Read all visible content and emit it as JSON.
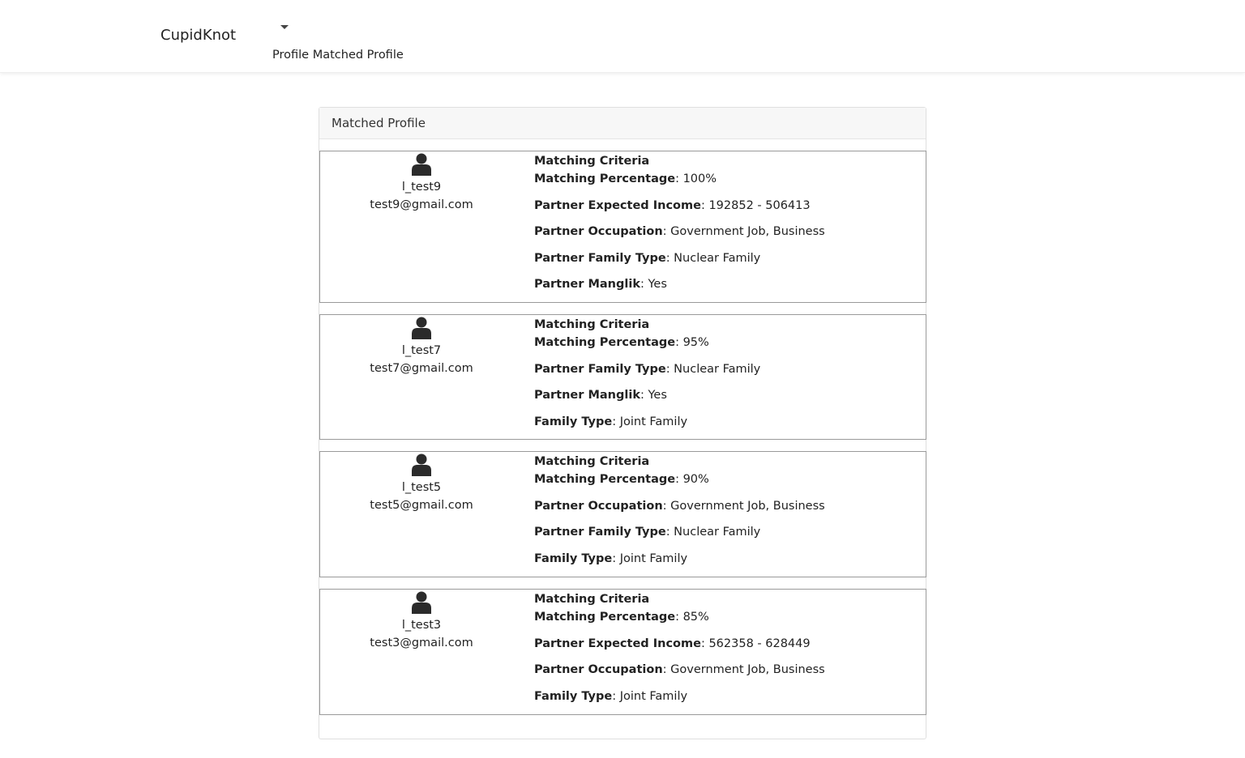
{
  "nav": {
    "brand": "CupidKnot",
    "links": [
      "Profile",
      "Matched Profile"
    ]
  },
  "card": {
    "header": "Matched Profile"
  },
  "criteria_title": "Matching Criteria",
  "profiles": [
    {
      "username": "l_test9",
      "email": "test9@gmail.com",
      "rows": [
        {
          "label": "Matching Percentage",
          "value": ": 100%"
        },
        {
          "label": "Partner Expected Income",
          "value": ": 192852 - 506413"
        },
        {
          "label": "Partner Occupation",
          "value": ": Government Job, Business"
        },
        {
          "label": "Partner Family Type",
          "value": ": Nuclear Family"
        },
        {
          "label": "Partner Manglik",
          "value": ": Yes"
        }
      ]
    },
    {
      "username": "l_test7",
      "email": "test7@gmail.com",
      "rows": [
        {
          "label": "Matching Percentage",
          "value": ": 95%"
        },
        {
          "label": "Partner Family Type",
          "value": ": Nuclear Family"
        },
        {
          "label": "Partner Manglik",
          "value": ": Yes"
        },
        {
          "label": "Family Type",
          "value": ": Joint Family"
        }
      ]
    },
    {
      "username": "l_test5",
      "email": "test5@gmail.com",
      "rows": [
        {
          "label": "Matching Percentage",
          "value": ": 90%"
        },
        {
          "label": "Partner Occupation",
          "value": ": Government Job, Business"
        },
        {
          "label": "Partner Family Type",
          "value": ": Nuclear Family"
        },
        {
          "label": "Family Type",
          "value": ": Joint Family"
        }
      ]
    },
    {
      "username": "l_test3",
      "email": "test3@gmail.com",
      "rows": [
        {
          "label": "Matching Percentage",
          "value": ": 85%"
        },
        {
          "label": "Partner Expected Income",
          "value": ": 562358 - 628449"
        },
        {
          "label": "Partner Occupation",
          "value": ": Government Job, Business"
        },
        {
          "label": "Family Type",
          "value": ": Joint Family"
        }
      ]
    }
  ]
}
